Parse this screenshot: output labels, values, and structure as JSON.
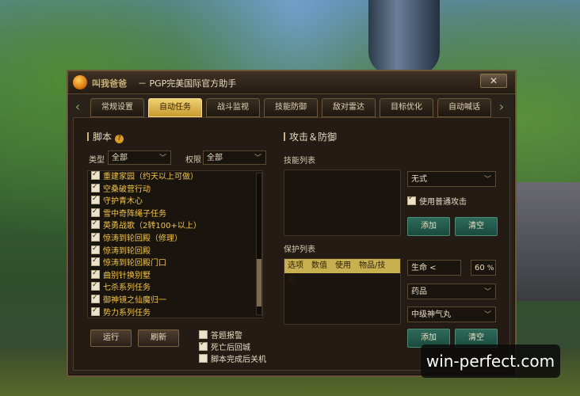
{
  "window": {
    "brand": "叫我爸爸",
    "title": "－ PGP完美国际官方助手",
    "close_glyph": "✕"
  },
  "tabs": [
    {
      "label": "常规设置",
      "active": false
    },
    {
      "label": "自动任务",
      "active": true
    },
    {
      "label": "战斗监视",
      "active": false
    },
    {
      "label": "技能防御",
      "active": false
    },
    {
      "label": "敌对雷达",
      "active": false
    },
    {
      "label": "目标优化",
      "active": false
    },
    {
      "label": "自动喊话",
      "active": false
    }
  ],
  "script_panel": {
    "title": "脚本",
    "help": "?",
    "type_label": "类型",
    "type_value": "全部",
    "perm_label": "权限",
    "perm_value": "全部",
    "tasks": [
      {
        "label": "重建家园（约天以上可做）",
        "checked": true
      },
      {
        "label": "空桑破营行动",
        "checked": true
      },
      {
        "label": "守护青木心",
        "checked": true
      },
      {
        "label": "雪中奇阵绳子任务",
        "checked": true
      },
      {
        "label": "英勇战歌（2转100+以上）",
        "checked": true
      },
      {
        "label": "惊涛到轮回殿（修理）",
        "checked": true
      },
      {
        "label": "惊涛到轮回殿",
        "checked": true
      },
      {
        "label": "惊涛到轮回殿门口",
        "checked": true
      },
      {
        "label": "曲别针换别墅",
        "checked": true
      },
      {
        "label": "七杀系列任务",
        "checked": true
      },
      {
        "label": "御神镜之仙魔归一",
        "checked": true
      },
      {
        "label": "势力系列任务",
        "checked": true
      }
    ],
    "run_label": "运行",
    "refresh_label": "刷新",
    "options": [
      {
        "label": "答题报警",
        "checked": false
      },
      {
        "label": "死亡后回城",
        "checked": true
      },
      {
        "label": "脚本完成后关机",
        "checked": false
      }
    ]
  },
  "attack_panel": {
    "title": "攻击＆防御",
    "skill_list_label": "技能列表",
    "skill_select": "无式",
    "use_normal_attack_label": "使用普通攻击",
    "use_normal_attack_checked": true,
    "add_label": "添加",
    "clear_label": "清空",
    "protect_list_label": "保护列表",
    "protect_columns": [
      "选项",
      "数值",
      "使用",
      "物品/技能"
    ],
    "stat_select": "生命 <",
    "stat_value": "60",
    "stat_unit": "%",
    "item_type_select": "药品",
    "item_select": "中级神气丸",
    "add2_label": "添加",
    "clear2_label": "清空"
  },
  "watermark": "win-perfect.com"
}
